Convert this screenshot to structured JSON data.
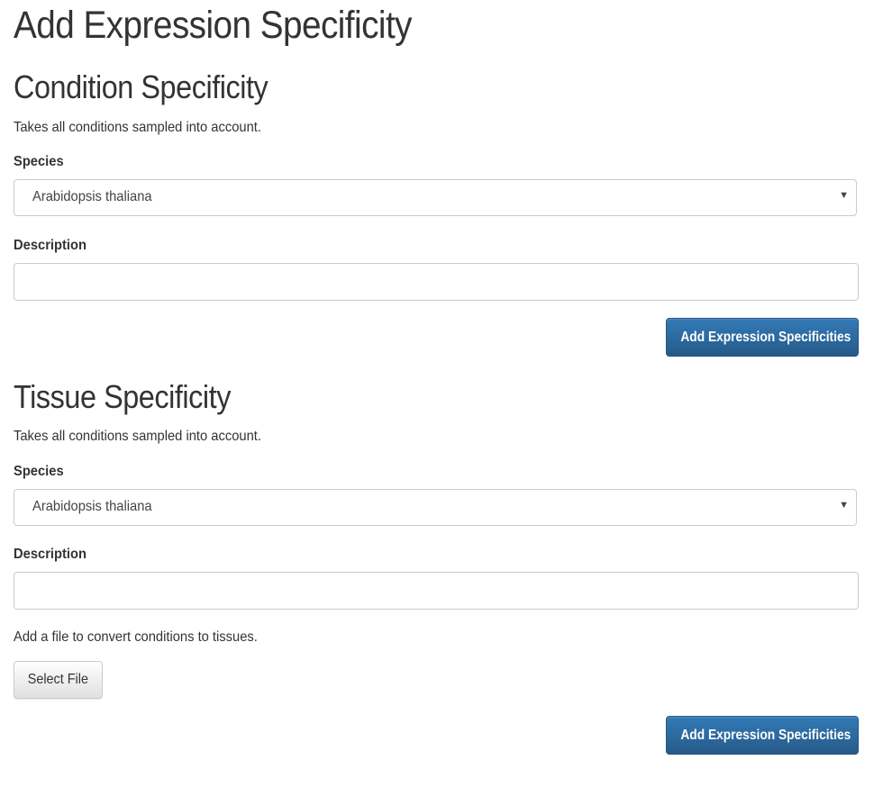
{
  "page": {
    "title": "Add Expression Specificity"
  },
  "condition_section": {
    "title": "Condition Specificity",
    "help_text": "Takes all conditions sampled into account.",
    "species_label": "Species",
    "species_selected": "Arabidopsis thaliana",
    "description_label": "Description",
    "description_value": "",
    "submit_label": "Add Expression Specificities"
  },
  "tissue_section": {
    "title": "Tissue Specificity",
    "help_text": "Takes all conditions sampled into account.",
    "species_label": "Species",
    "species_selected": "Arabidopsis thaliana",
    "description_label": "Description",
    "description_value": "",
    "file_help_text": "Add a file to convert conditions to tissues.",
    "file_button_label": "Select File",
    "submit_label": "Add Expression Specificities"
  },
  "icons": {
    "dropdown": "caret-down-icon"
  },
  "colors": {
    "primary_button": "#337ab7",
    "primary_button_dark": "#265a88",
    "text": "#333333",
    "border": "#cccccc"
  }
}
